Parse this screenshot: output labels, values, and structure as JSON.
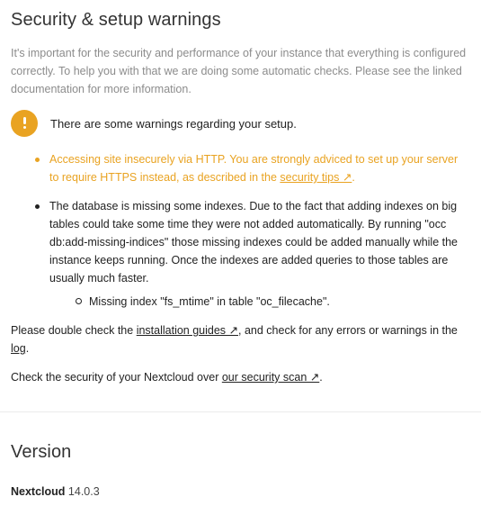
{
  "security": {
    "title": "Security & setup warnings",
    "description": "It's important for the security and performance of your instance that everything is configured correctly. To help you with that we are doing some automatic checks. Please see the linked documentation for more information.",
    "warning_banner": "There are some warnings regarding your setup.",
    "issues": [
      {
        "text_before": "Accessing site insecurely via HTTP. You are strongly adviced to set up your server to require HTTPS instead, as described in the ",
        "link": "security tips ↗",
        "text_after": "."
      },
      {
        "text": "The database is missing some indexes. Due to the fact that adding indexes on big tables could take some time they were not added automatically. By running \"occ db:add-missing-indices\" those missing indexes could be added manually while the instance keeps running. Once the indexes are added queries to those tables are usually much faster.",
        "sub_items": [
          "Missing index \"fs_mtime\" in table \"oc_filecache\"."
        ]
      }
    ],
    "double_check": {
      "before": "Please double check the ",
      "link1": "installation guides ↗",
      "middle": ", and check for any errors or warnings in the ",
      "link2": "log",
      "after": "."
    },
    "scan": {
      "before": "Check the security of your Nextcloud over ",
      "link": "our security scan ↗",
      "after": "."
    }
  },
  "version": {
    "title": "Version",
    "product": "Nextcloud",
    "number": "14.0.3"
  },
  "colors": {
    "warning": "#e9a322",
    "muted_text": "#8c8c8c",
    "text": "#222222"
  },
  "icons": {
    "warning": "exclamation-circle-icon",
    "external_link": "arrow-up-right-icon"
  }
}
